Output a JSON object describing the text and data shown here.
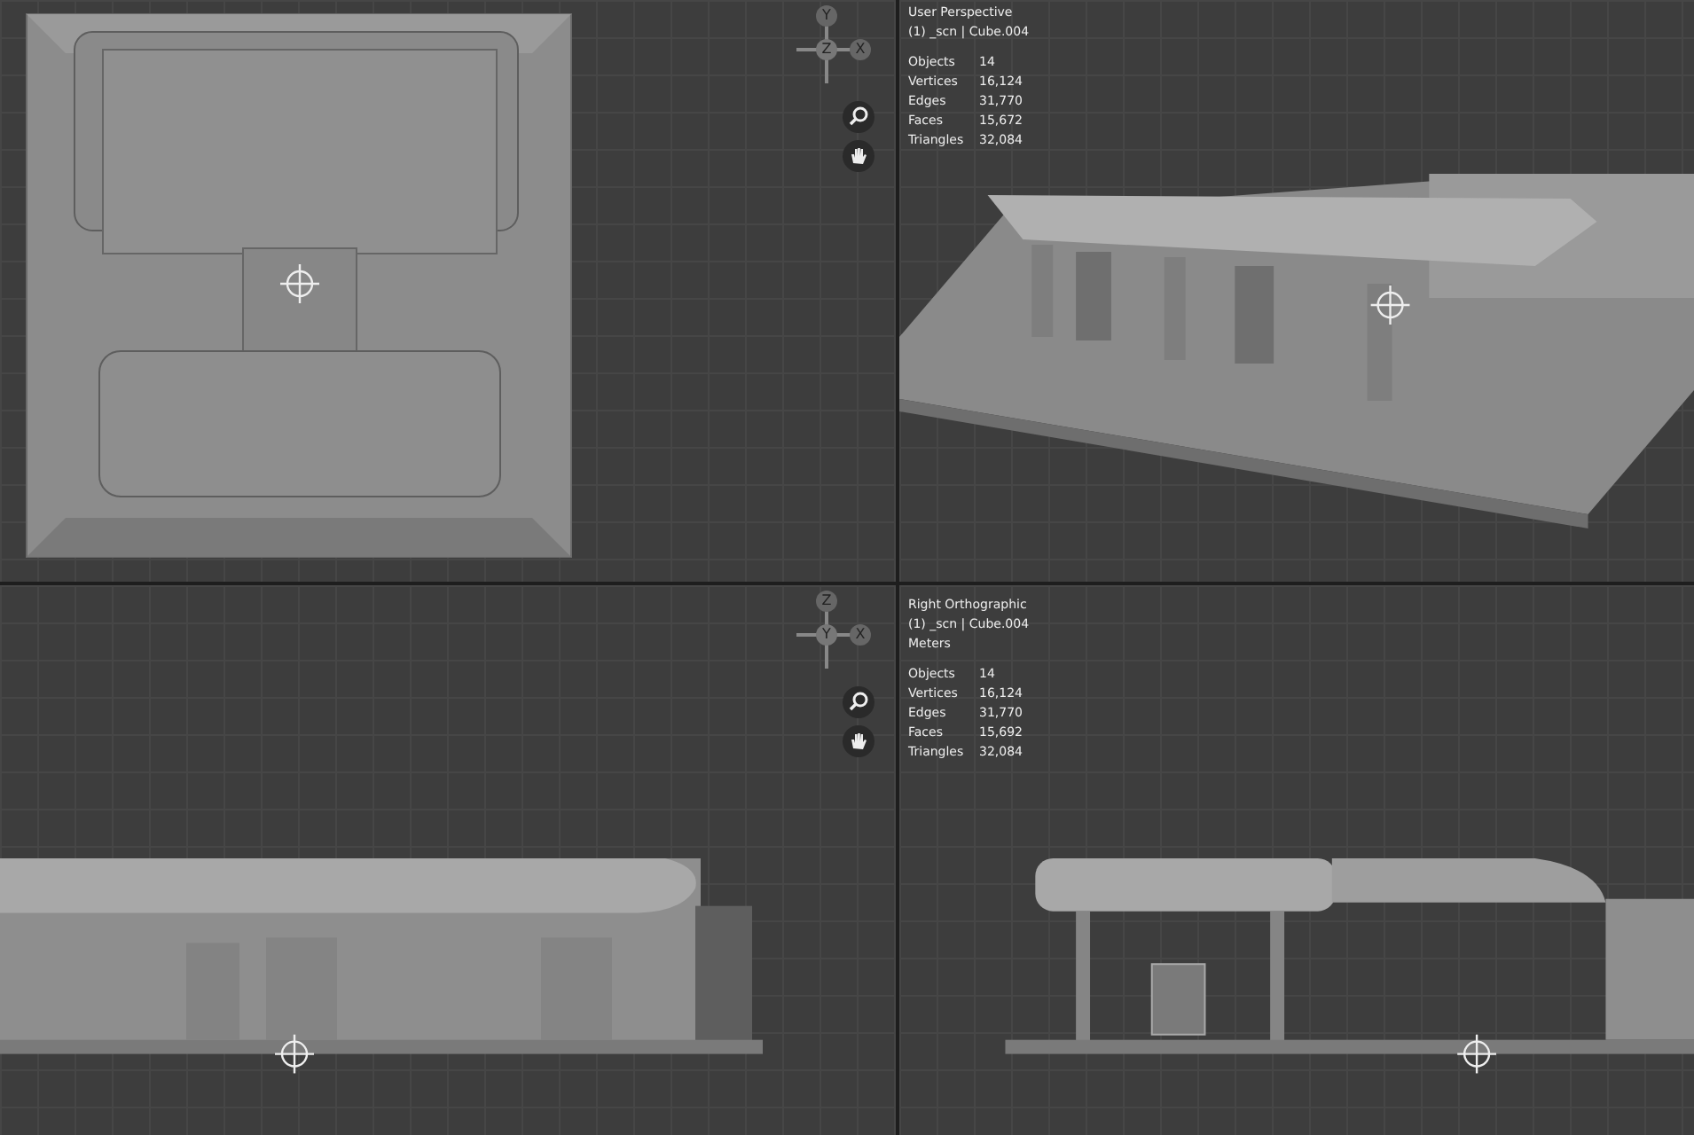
{
  "viewports": [
    {
      "kind": "top",
      "gizmo": {
        "top": "Y",
        "center": "Z",
        "right": "X"
      }
    },
    {
      "kind": "perspective",
      "overlay": {
        "title": "User Perspective",
        "object": "(1) _scn | Cube.004",
        "stats": [
          {
            "label": "Objects",
            "value": "14"
          },
          {
            "label": "Vertices",
            "value": "16,124"
          },
          {
            "label": "Edges",
            "value": "31,770"
          },
          {
            "label": "Faces",
            "value": "15,672"
          },
          {
            "label": "Triangles",
            "value": "32,084"
          }
        ]
      }
    },
    {
      "kind": "side-left",
      "gizmo": {
        "top": "Z",
        "center": "Y",
        "right": "X"
      }
    },
    {
      "kind": "side-right",
      "overlay": {
        "title": "Right Orthographic",
        "object": "(1) _scn | Cube.004",
        "units": "Meters",
        "stats": [
          {
            "label": "Objects",
            "value": "14"
          },
          {
            "label": "Vertices",
            "value": "16,124"
          },
          {
            "label": "Edges",
            "value": "31,770"
          },
          {
            "label": "Faces",
            "value": "15,692"
          },
          {
            "label": "Triangles",
            "value": "32,084"
          }
        ]
      }
    }
  ]
}
